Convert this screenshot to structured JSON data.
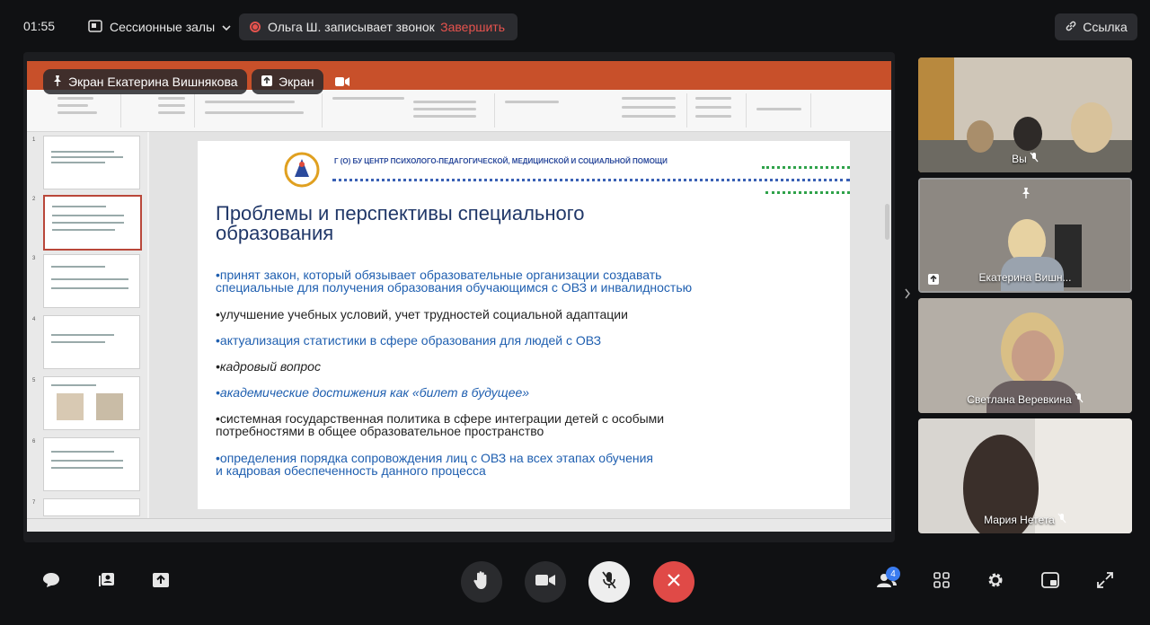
{
  "topbar": {
    "time": "01:55",
    "session_label": "Сессионные залы",
    "recording_text": "Ольга Ш. записывает звонок",
    "end_label": "Завершить",
    "link_label": "Ссылка"
  },
  "screen_share": {
    "presenter_label": "Экран Екатерина Вишнякова",
    "screen_label": "Экран"
  },
  "slide": {
    "org": "Г (О) БУ ЦЕНТР ПСИХОЛОГО-ПЕДАГОГИЧЕСКОЙ, МЕДИЦИНСКОЙ И СОЦИАЛЬНОЙ ПОМОЩИ",
    "title_line1": "Проблемы и перспективы специального",
    "title_line2": "образования",
    "bullets": [
      {
        "l1": "•принят закон, который обязывает образовательные организации создавать",
        "l2": "специальные для получения образования обучающимся с ОВЗ и инвалидностью"
      },
      {
        "l1": "•улучшение учебных условий, учет трудностей социальной адаптации",
        "l2": ""
      },
      {
        "l1": "•актуализация статистики в сфере образования для людей с ОВЗ",
        "l2": ""
      },
      {
        "l1": "•кадровый вопрос",
        "l2": ""
      },
      {
        "l1": "•академические достижения как «билет в будущее»",
        "l2": ""
      },
      {
        "l1": "•системная государственная политика в сфере интеграции детей с особыми",
        "l2": "потребностями в общее образовательное пространство"
      },
      {
        "l1": "•определения порядка сопровождения лиц с ОВЗ на всех этапах обучения",
        "l2": "и кадровая обеспеченность данного процесса"
      }
    ]
  },
  "participants": [
    {
      "name": "Вы"
    },
    {
      "name": "Екатерина Вишн..."
    },
    {
      "name": "Светлана Веревкина"
    },
    {
      "name": "Мария Нетета"
    }
  ],
  "controls": {
    "participants_count": "4"
  }
}
